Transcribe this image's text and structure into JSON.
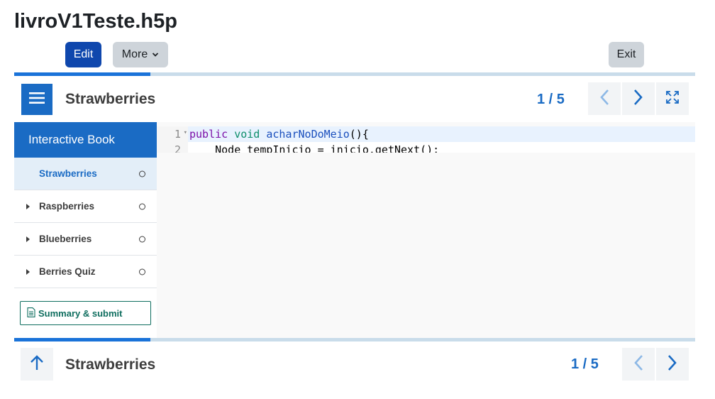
{
  "page": {
    "title": "livroV1Teste.h5p"
  },
  "toolbar": {
    "edit_label": "Edit",
    "more_label": "More",
    "exit_label": "Exit"
  },
  "progress": {
    "fraction": 0.2
  },
  "header": {
    "chapter_title": "Strawberries",
    "page_count": "1 / 5"
  },
  "sidebar": {
    "title": "Interactive Book",
    "items": [
      {
        "label": "Strawberries",
        "active": true
      },
      {
        "label": "Raspberries",
        "active": false
      },
      {
        "label": "Blueberries",
        "active": false
      },
      {
        "label": "Berries Quiz",
        "active": false
      }
    ],
    "summary_label": "Summary & submit"
  },
  "editor": {
    "lines": [
      {
        "number": "1",
        "tokens": [
          [
            "public",
            "kw"
          ],
          [
            " ",
            ""
          ],
          [
            "void",
            "kt"
          ],
          [
            " ",
            ""
          ],
          [
            "acharNoDoMeio",
            "fn"
          ],
          [
            "(){",
            ""
          ]
        ]
      },
      {
        "number": "2",
        "tokens": [
          [
            "    Node tempInicio = inicio.getNext();",
            ""
          ]
        ]
      }
    ]
  },
  "footer": {
    "chapter_title": "Strawberries",
    "page_count": "1 / 5"
  },
  "colors": {
    "accent": "#1a6bc4",
    "edit_button": "#0f47ad",
    "progress_track": "#c9dcea",
    "summary": "#0f6e5f"
  }
}
